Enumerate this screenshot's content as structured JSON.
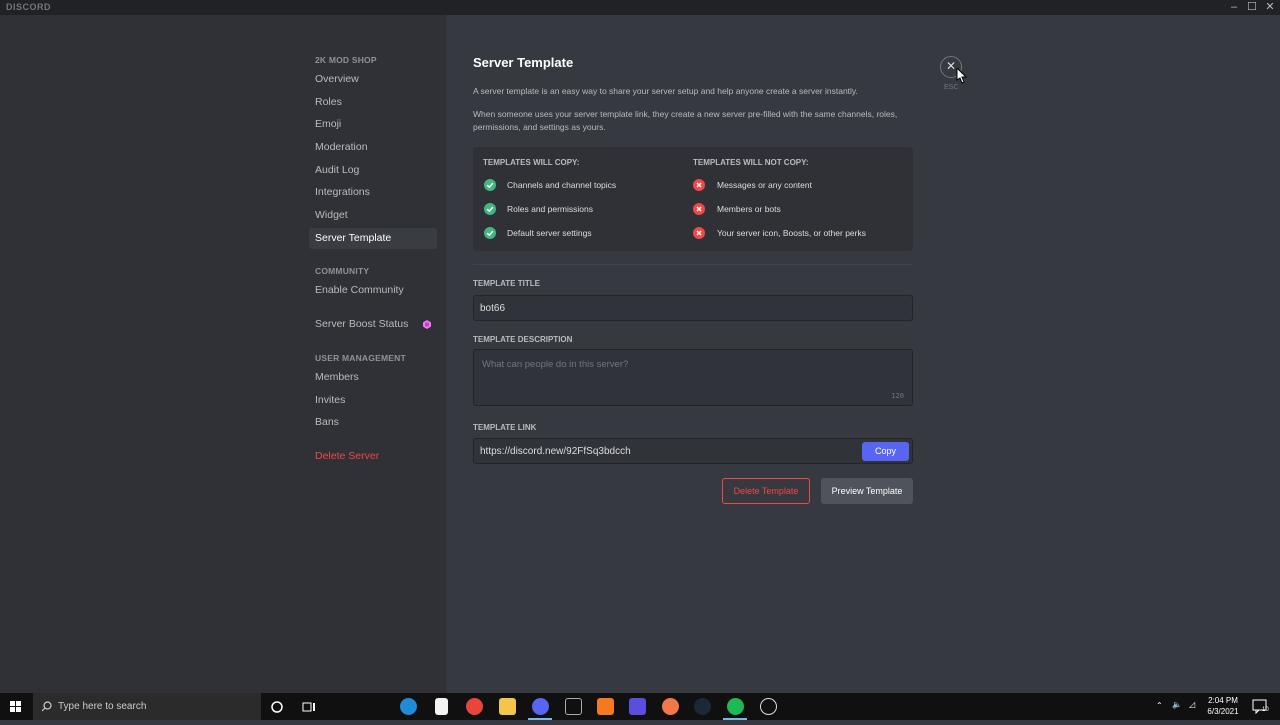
{
  "window": {
    "brand": "DISCORD"
  },
  "sidebar": {
    "server_header": "2K MOD SHOP",
    "items": [
      {
        "label": "Overview"
      },
      {
        "label": "Roles"
      },
      {
        "label": "Emoji"
      },
      {
        "label": "Moderation"
      },
      {
        "label": "Audit Log"
      },
      {
        "label": "Integrations"
      },
      {
        "label": "Widget"
      },
      {
        "label": "Server Template",
        "selected": true
      }
    ],
    "community_header": "COMMUNITY",
    "community_items": [
      {
        "label": "Enable Community"
      }
    ],
    "boost_item": {
      "label": "Server Boost Status"
    },
    "user_mgmt_header": "USER MANAGEMENT",
    "user_mgmt_items": [
      {
        "label": "Members"
      },
      {
        "label": "Invites"
      },
      {
        "label": "Bans"
      }
    ],
    "delete_server": "Delete Server"
  },
  "main": {
    "title": "Server Template",
    "desc1": "A server template is an easy way to share your server setup and help anyone create a server instantly.",
    "desc2": "When someone uses your server template link, they create a new server pre-filled with the same channels, roles, permissions, and settings as yours.",
    "close_glyph": "✕",
    "esc_label": "ESC",
    "will_copy": {
      "heading": "TEMPLATES WILL COPY:",
      "items": [
        "Channels and channel topics",
        "Roles and permissions",
        "Default server settings"
      ]
    },
    "will_not_copy": {
      "heading": "TEMPLATES WILL NOT COPY:",
      "items": [
        "Messages or any content",
        "Members or bots",
        "Your server icon, Boosts, or other perks"
      ]
    },
    "template_title": {
      "label": "TEMPLATE TITLE",
      "value": "bot66"
    },
    "template_description": {
      "label": "TEMPLATE DESCRIPTION",
      "placeholder": "What can people do in this server?",
      "counter": "120"
    },
    "template_link": {
      "label": "TEMPLATE LINK",
      "value": "https://discord.new/92FfSq3bdcch",
      "copy_label": "Copy"
    },
    "delete_template": "Delete Template",
    "preview_template": "Preview Template"
  },
  "taskbar": {
    "search_placeholder": "Type here to search",
    "time": "2:04 PM",
    "date": "6/3/2021",
    "notification_count": "10"
  },
  "colors": {
    "accent": "#5865f2",
    "success": "#43b581",
    "danger": "#f04747",
    "boost": "#ff73fa"
  }
}
